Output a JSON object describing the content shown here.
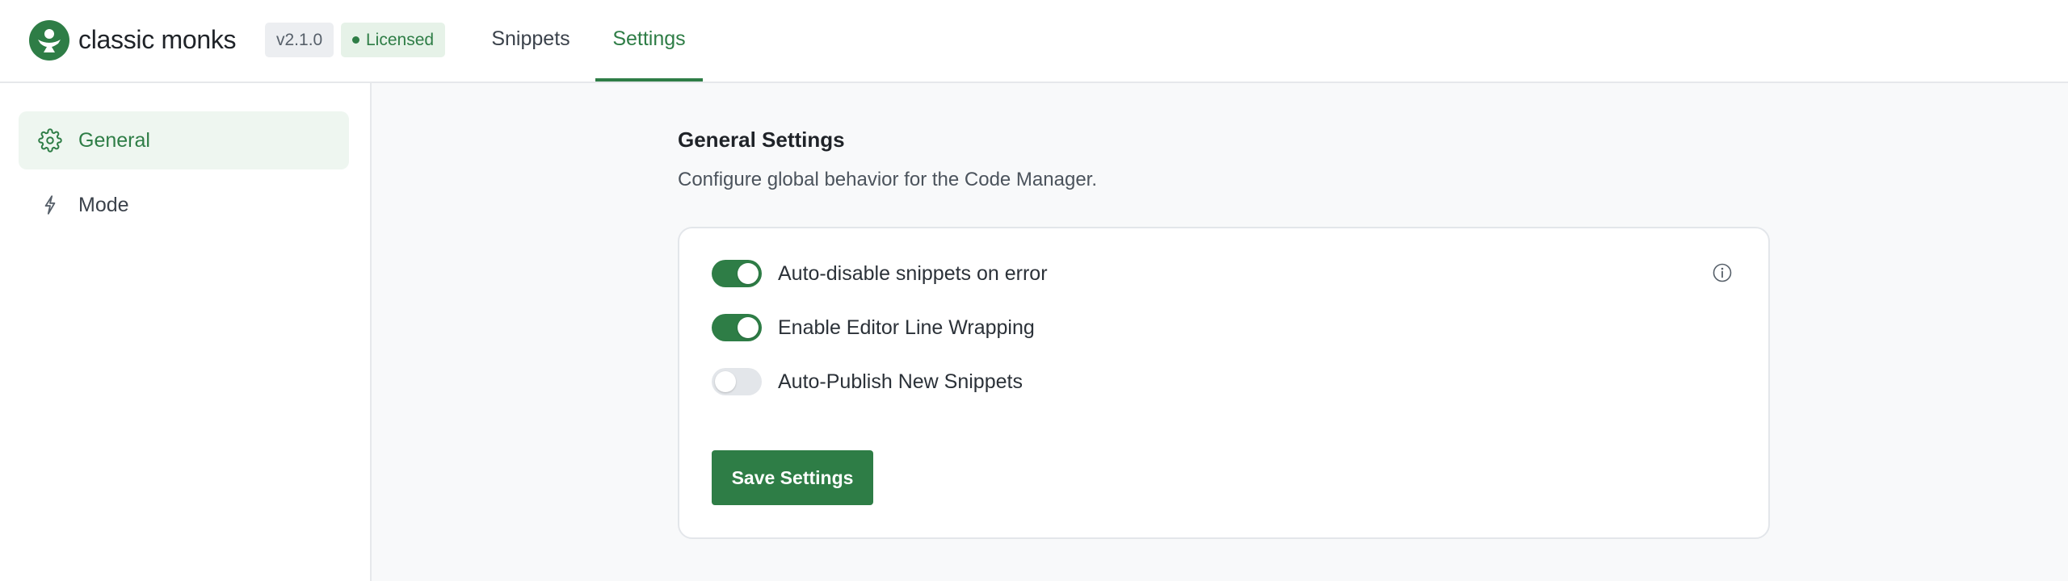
{
  "header": {
    "brand": "classic monks",
    "logo_icon": "monk-logo-icon",
    "version": "v2.1.0",
    "license_status": "Licensed",
    "tabs": [
      {
        "label": "Snippets",
        "active": false
      },
      {
        "label": "Settings",
        "active": true
      }
    ]
  },
  "sidebar": {
    "items": [
      {
        "label": "General",
        "icon": "gear-icon",
        "active": true
      },
      {
        "label": "Mode",
        "icon": "lightning-icon",
        "active": false
      }
    ]
  },
  "main": {
    "title": "General Settings",
    "description": "Configure global behavior for the Code Manager.",
    "settings": [
      {
        "label": "Auto-disable snippets on error",
        "enabled": true,
        "has_info": true
      },
      {
        "label": "Enable Editor Line Wrapping",
        "enabled": true,
        "has_info": false
      },
      {
        "label": "Auto-Publish New Snippets",
        "enabled": false,
        "has_info": false
      }
    ],
    "save_label": "Save Settings"
  },
  "colors": {
    "accent": "#2e7d46",
    "accent_light": "#eef6f0",
    "background": "#f8f9fa",
    "toggle_off": "#e3e6ea"
  }
}
